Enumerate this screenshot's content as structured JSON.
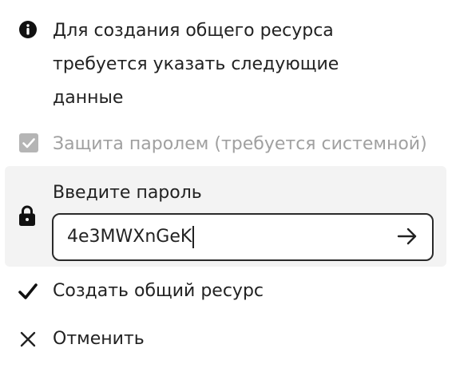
{
  "notice": {
    "icon": "info-icon",
    "line1": "Для создания общего ресурса",
    "line2": "требуется указать следующие",
    "line3": "данные"
  },
  "password_protection": {
    "checked": true,
    "disabled": true,
    "label": "Защита паролем (требуется системной)"
  },
  "password": {
    "icon": "lock-icon",
    "label": "Введите пароль",
    "value": "4e3MWXnGeK",
    "submit_icon": "arrow-right-icon"
  },
  "actions": {
    "create": {
      "icon": "checkmark-icon",
      "label": "Создать общий ресурс"
    },
    "cancel": {
      "icon": "close-icon",
      "label": "Отменить"
    }
  },
  "colors": {
    "text": "#222222",
    "disabled_text": "#a0a0a0",
    "disabled_checkbox": "#b5b5b5",
    "section_background": "#f3f3f3",
    "field_border": "#2a2a2a"
  }
}
